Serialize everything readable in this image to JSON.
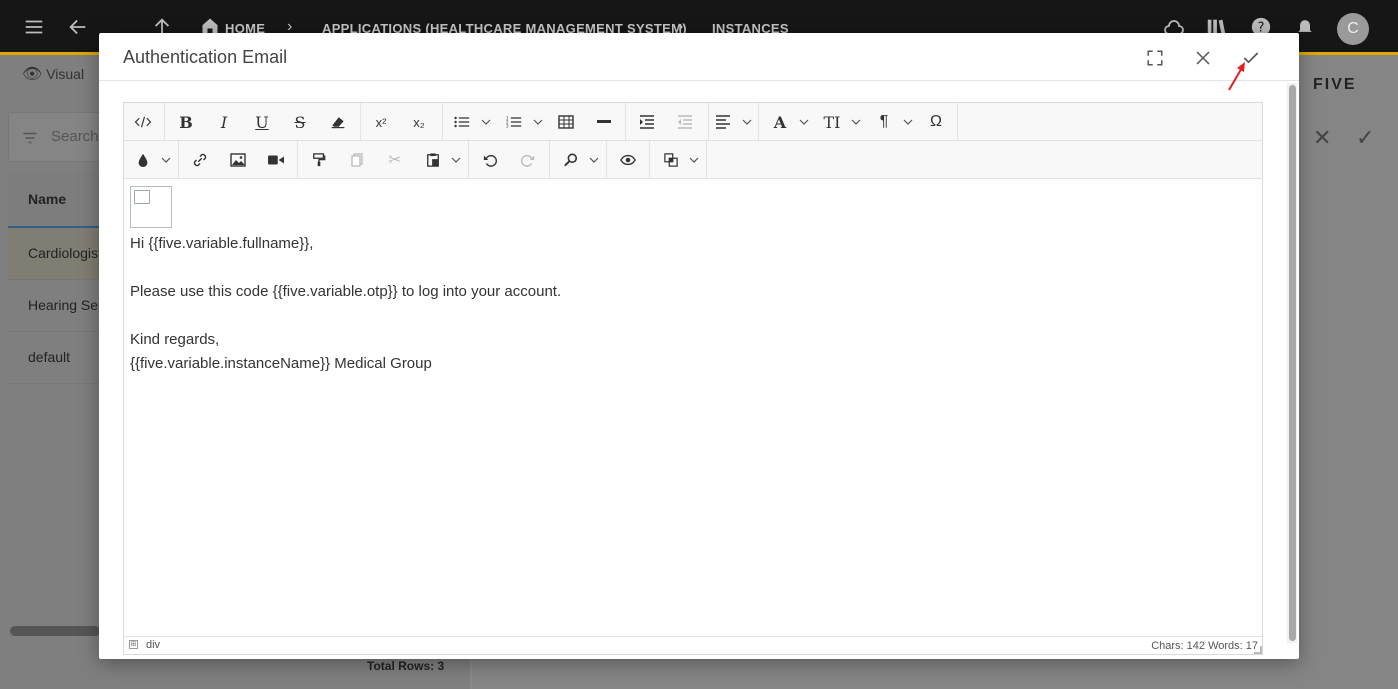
{
  "topbar": {
    "breadcrumbs": [
      "HOME",
      "APPLICATIONS (HEALTHCARE MANAGEMENT SYSTEM)",
      "INSTANCES"
    ],
    "avatar_letter": "C"
  },
  "background": {
    "visual_label": "Visual",
    "search_placeholder": "Search",
    "table_header": "Name",
    "rows": [
      "Cardiologist",
      "Hearing Ser",
      "default"
    ],
    "total_rows": "Total Rows: 3",
    "brand": "FIVE"
  },
  "modal": {
    "title": "Authentication Email",
    "editor": {
      "paragraphs": [
        "Hi {{five.variable.fullname}},",
        "",
        "Please use this code {{five.variable.otp}} to log into your account.",
        "",
        "Kind regards,",
        "{{five.variable.instanceName}} Medical Group"
      ],
      "status_path": "div",
      "status_counts": "Chars: 142   Words: 17"
    }
  },
  "colors": {
    "topbar_bg": "#161616",
    "accent": "#e0a800",
    "annotation_arrow": "#e02020"
  }
}
